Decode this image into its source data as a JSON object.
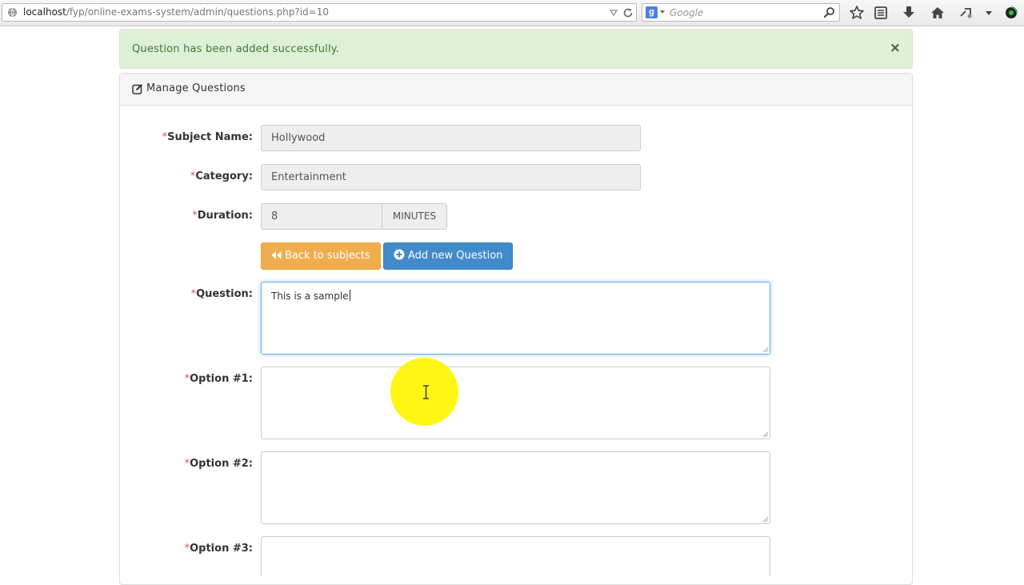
{
  "browser": {
    "url_host": "localhost",
    "url_path": "/fyp/online-exams-system/admin/questions.php?id=10",
    "search_engine": "Google",
    "search_placeholder": "Google"
  },
  "alert": {
    "message": "Question has been added successfully.",
    "close_label": "×",
    "color": "#3c763d"
  },
  "panel": {
    "title": "Manage Questions",
    "title_icon": "edit-icon"
  },
  "form": {
    "required_mark": "*",
    "subject": {
      "label": "Subject Name:",
      "value": "Hollywood"
    },
    "category": {
      "label": "Category:",
      "value": "Entertainment"
    },
    "duration": {
      "label": "Duration:",
      "value": "8",
      "unit": "MINUTES"
    },
    "question": {
      "label": "Question:",
      "value": "This is a sample"
    },
    "option1": {
      "label": "Option #1:",
      "value": ""
    },
    "option2": {
      "label": "Option #2:",
      "value": ""
    },
    "option3": {
      "label": "Option #3:",
      "value": ""
    }
  },
  "buttons": {
    "back": {
      "label": "Back to subjects",
      "icon": "backward-icon",
      "color": "#f0ad4e"
    },
    "add": {
      "label": "Add new Question",
      "icon": "plus-circle-icon",
      "color": "#428bca"
    }
  }
}
